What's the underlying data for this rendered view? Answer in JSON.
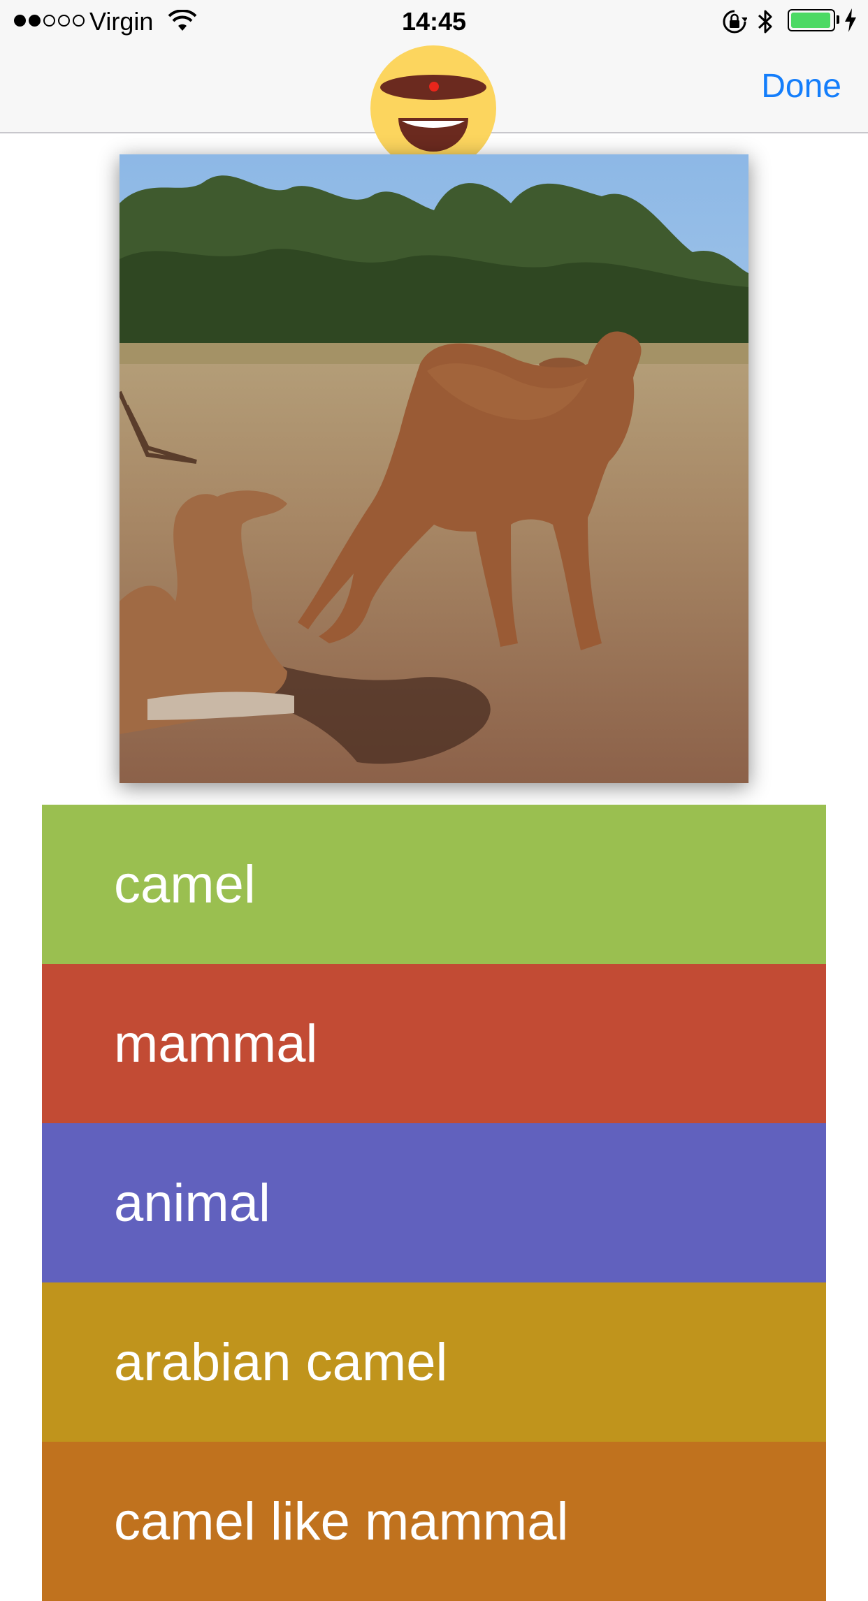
{
  "status_bar": {
    "carrier": "Virgin",
    "time": "14:45",
    "signal_bars_filled": 2,
    "signal_bars_total": 5,
    "battery_level": 0.85
  },
  "nav": {
    "done_label": "Done"
  },
  "photo": {
    "description_icon": "camel-photo"
  },
  "labels": [
    {
      "text": "camel",
      "color": "#9abf50"
    },
    {
      "text": "mammal",
      "color": "#c24b34"
    },
    {
      "text": "animal",
      "color": "#6161be"
    },
    {
      "text": "arabian camel",
      "color": "#c0941c"
    },
    {
      "text": "camel like mammal",
      "color": "#c0721e"
    }
  ],
  "colors": {
    "accent": "#147efb",
    "face": "#fcd55e",
    "face_dark": "#6b2a1f",
    "battery": "#4cd964"
  }
}
